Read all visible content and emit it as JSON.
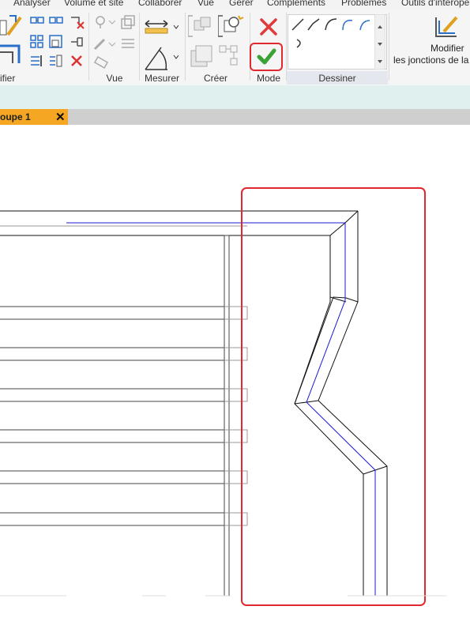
{
  "menu": {
    "items": [
      "Analyser",
      "Volume et site",
      "Collaborer",
      "Vue",
      "Gérer",
      "Compléments",
      "Problèmes",
      "Outils d'interopé"
    ]
  },
  "ribbon": {
    "panels": {
      "modify": "ifier",
      "view": "Vue",
      "measure": "Mesurer",
      "create": "Créer",
      "mode": "Mode",
      "draw": "Dessiner"
    },
    "modify_joins": {
      "line1": "Modifier",
      "line2": "les jonctions de la"
    },
    "mode_cancel_icon": "cancel-x-icon",
    "mode_finish_icon": "finish-checkmark-icon"
  },
  "tab": {
    "label": "oupe 1",
    "close": "✕"
  },
  "colors": {
    "tab_active": "#f5a623",
    "highlight_red": "#e0282e",
    "sketch_blue": "#1a1ad6",
    "finish_green": "#3aa335",
    "cancel_red": "#e03a3a"
  }
}
